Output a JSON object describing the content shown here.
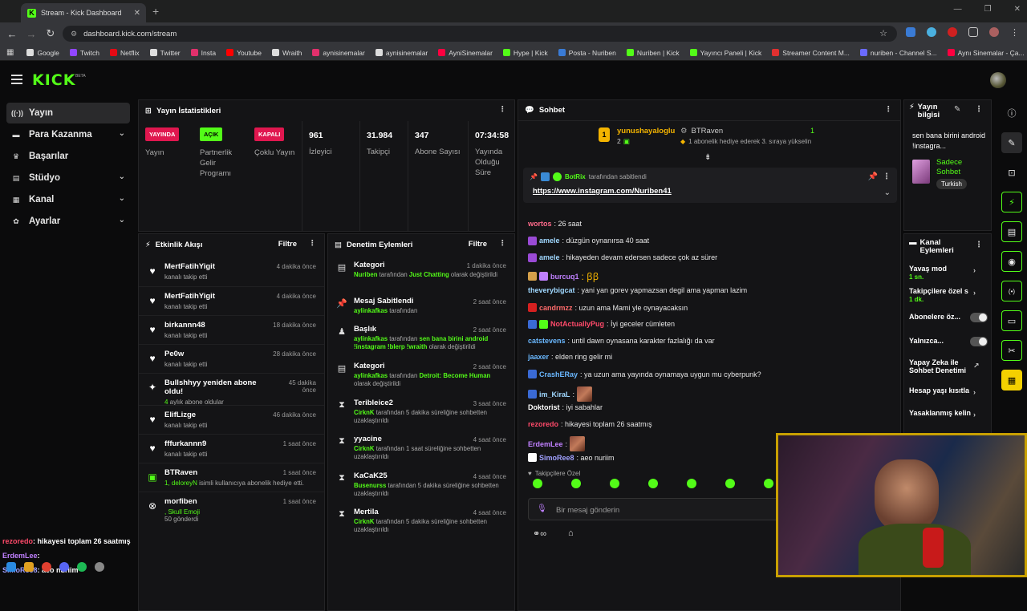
{
  "browser": {
    "tab_title": "Stream - Kick Dashboard",
    "url": "dashboard.kick.com/stream",
    "bookmarks": [
      "Google",
      "Twitch",
      "Netflix",
      "Twitter",
      "Insta",
      "Youtube",
      "Wraith",
      "aynisinemalar",
      "aynisinemalar",
      "AyniSinemalar",
      "Hype | Kick",
      "Posta - Nuriben",
      "Nuriben | Kick",
      "Yayıncı Paneli | Kick",
      "Streamer Content M...",
      "nuriben - Channel S...",
      "Aynı Sinemalar - Ça..."
    ]
  },
  "app": {
    "logo": "KICK",
    "beta": "BETA"
  },
  "sidebar": {
    "items": [
      {
        "label": "Yayın",
        "icon": "broadcast-icon"
      },
      {
        "label": "Para Kazanma",
        "icon": "money-icon"
      },
      {
        "label": "Başarılar",
        "icon": "trophy-icon"
      },
      {
        "label": "Stüdyo",
        "icon": "studio-icon"
      },
      {
        "label": "Kanal",
        "icon": "channel-icon"
      },
      {
        "label": "Ayarlar",
        "icon": "gear-icon"
      }
    ]
  },
  "stats": {
    "title": "Yayın İstatistikleri",
    "badges": [
      {
        "badge": "YAYINDA",
        "label": "Yayın"
      },
      {
        "badge": "AÇIK",
        "label": "Partnerlik Gelir Programı"
      },
      {
        "badge": "KAPALI",
        "label": "Çoklu Yayın"
      }
    ],
    "numbers": [
      {
        "value": "961",
        "label": "İzleyici"
      },
      {
        "value": "31.984",
        "label": "Takipçi"
      },
      {
        "value": "347",
        "label": "Abone Sayısı"
      },
      {
        "value": "07:34:58",
        "label": "Yayında Olduğu Süre"
      }
    ]
  },
  "activity": {
    "title": "Etkinlik Akışı",
    "filter": "Filtre",
    "rows": [
      {
        "name": "MertFatihYigit",
        "sub": "kanalı takip etti",
        "when": "4 dakika önce"
      },
      {
        "name": "MertFatihYigit",
        "sub": "kanalı takip etti",
        "when": "4 dakika önce"
      },
      {
        "name": "birkannn48",
        "sub": "kanalı takip etti",
        "when": "18 dakika önce"
      },
      {
        "name": "Pe0w",
        "sub": "kanalı takip etti",
        "when": "28 dakika önce"
      },
      {
        "name": "Bullshhyy yeniden abone oldu!",
        "sub_green": "4",
        "sub": " aylık abone oldular",
        "when": "45 dakika önce"
      },
      {
        "name": "ElifLizge",
        "sub": "kanalı takip etti",
        "when": "46 dakika önce"
      },
      {
        "name": "fffurkannn9",
        "sub": "kanalı takip etti",
        "when": "1 saat önce"
      },
      {
        "name": "BTRaven",
        "sub_green": "1, deloreyN",
        "sub": " isimli kullanıcıya abonelik hediye etti.",
        "when": "1 saat önce"
      },
      {
        "name": "morfiben",
        "sub_green": ", Skull Emoji",
        "sub": "50 gönderdi",
        "when": "1 saat önce"
      }
    ]
  },
  "moderation": {
    "title": "Denetim Eylemleri",
    "filter": "Filtre",
    "rows": [
      {
        "title": "Kategori",
        "when": "1 dakika önce",
        "a": "Nuriben",
        "b": " tarafından ",
        "c": "Just Chatting",
        "d": " olarak değiştirildi"
      },
      {
        "title": "Mesaj Sabitlendi",
        "when": "2 saat önce",
        "a": "aylinkafkas",
        "b": " tarafından",
        "c": "",
        "d": ""
      },
      {
        "title": "Başlık",
        "when": "2 saat önce",
        "a": "aylinkafkas",
        "b": " tarafından ",
        "c": "sen bana birini android !instagram !blerp !wraith",
        "d": " olarak değiştirildi"
      },
      {
        "title": "Kategori",
        "when": "2 saat önce",
        "a": "aylinkafkas",
        "b": " tarafından ",
        "c": "Detroit: Become Human",
        "d": " olarak değiştirildi"
      },
      {
        "title": "Teribleice2",
        "when": "3 saat önce",
        "a": "CirknK",
        "b": " tarafından 5 dakika süreliğine sohbetten uzaklaştırıldı",
        "c": "",
        "d": ""
      },
      {
        "title": "yyacine",
        "when": "4 saat önce",
        "a": "CirknK",
        "b": " tarafından 1 saat süreliğine sohbetten uzaklaştırıldı",
        "c": "",
        "d": ""
      },
      {
        "title": "KaCaK25",
        "when": "4 saat önce",
        "a": "Busenurss",
        "b": " tarafından 5 dakika süreliğine sohbetten uzaklaştırıldı",
        "c": "",
        "d": ""
      },
      {
        "title": "Mertila",
        "when": "4 saat önce",
        "a": "CirknK",
        "b": " tarafından 5 dakika süreliğine sohbetten uzaklaştırıldı",
        "c": "",
        "d": ""
      }
    ]
  },
  "chat": {
    "title": "Sohbet",
    "gift": {
      "sender": "yunushayaloglu",
      "sender_count": "2",
      "receiver": "BTRaven",
      "receiver_count": "1",
      "rank": "1",
      "text": "1 abonelik hediye ederek 3. sıraya yükselin"
    },
    "pinned": {
      "by": "BotRix",
      "by_suffix": " tarafından sabitlendi",
      "link": "https://www.instagram.com/Nuriben41"
    },
    "messages": [
      {
        "user": "wortos",
        "color": "#ff6b8b",
        "text": ": 26 saat"
      },
      {
        "user": "amele",
        "color": "#a0d8ff",
        "text": ": düzgün oynanırsa 40 saat"
      },
      {
        "user": "amele",
        "color": "#a0d8ff",
        "text": ": hikayeden devam edersen sadece çok az sürer"
      },
      {
        "user": "burcuq1",
        "color": "#c080ff",
        "text": ": ꞵꞵ"
      },
      {
        "user": "theverybigcat",
        "color": "#a0d8ff",
        "text": ": yani yan gorev yapmazsan degil ama yapman lazim"
      },
      {
        "user": "candrmzz",
        "color": "#ff6b6b",
        "text": ": uzun ama Mami yle oynayacaksın"
      },
      {
        "user": "NotActuallyPug",
        "color": "#ff4a6a",
        "text": ": İyi geceler cümleten"
      },
      {
        "user": "catstevens",
        "color": "#6ab8ff",
        "text": ": until dawn oynasana karakter fazlalığı da var"
      },
      {
        "user": "jaaxer",
        "color": "#6ab8ff",
        "text": ": elden ring gelir mi"
      },
      {
        "user": "CrashERay",
        "color": "#6ab8ff",
        "text": ": ya uzun ama yayında oynamaya uygun mu cyberpunk?"
      },
      {
        "user": "im_KiraL",
        "color": "#a0d8ff",
        "text": ":"
      },
      {
        "user": "Doktorist",
        "color": "#ffffff",
        "text": ": iyi sabahlar"
      },
      {
        "user": "rezoredo",
        "color": "#ff4a6a",
        "text": ": hikayesi toplam 26 saatmış"
      },
      {
        "user": "ErdemLee",
        "color": "#c080ff",
        "text": ":"
      },
      {
        "user": "SimoRee8",
        "color": "#a0a0ff",
        "text": ": aeo nuriim"
      }
    ],
    "followers_only": "Takipçilere Özel",
    "input_placeholder": "Bir mesaj gönderin"
  },
  "stream_info": {
    "title": "Yayın bilgisi",
    "stream_title": "sen bana birini android !instagra...",
    "category": "Sadece Sohbet",
    "language": "Turkish"
  },
  "channel_actions": {
    "title": "Kanal Eylemleri",
    "items": [
      {
        "label": "Yavaş mod",
        "sub": "1 sn."
      },
      {
        "label": "Takipçilere özel s",
        "sub": "1 dk."
      },
      {
        "label": "Abonelere öz...",
        "sub": ""
      },
      {
        "label": "Yalnızca...",
        "sub": ""
      },
      {
        "label": "Yapay Zeka ile Sohbet Denetimi",
        "sub": ""
      },
      {
        "label": "Hesap yaşı kısıtla",
        "sub": ""
      },
      {
        "label": "Yasaklanmış kelin",
        "sub": ""
      }
    ]
  },
  "overlay": [
    {
      "user": "rezoredo",
      "text": ": hikayesi toplam 26 saatmış"
    },
    {
      "user": "ErdemLee",
      "text": ":"
    },
    {
      "user": "SimoRee8",
      "text": ": aeo nuriim"
    }
  ],
  "colors": {
    "kick_green": "#53fc18",
    "live_red": "#e0174f",
    "panel": "#141416"
  }
}
